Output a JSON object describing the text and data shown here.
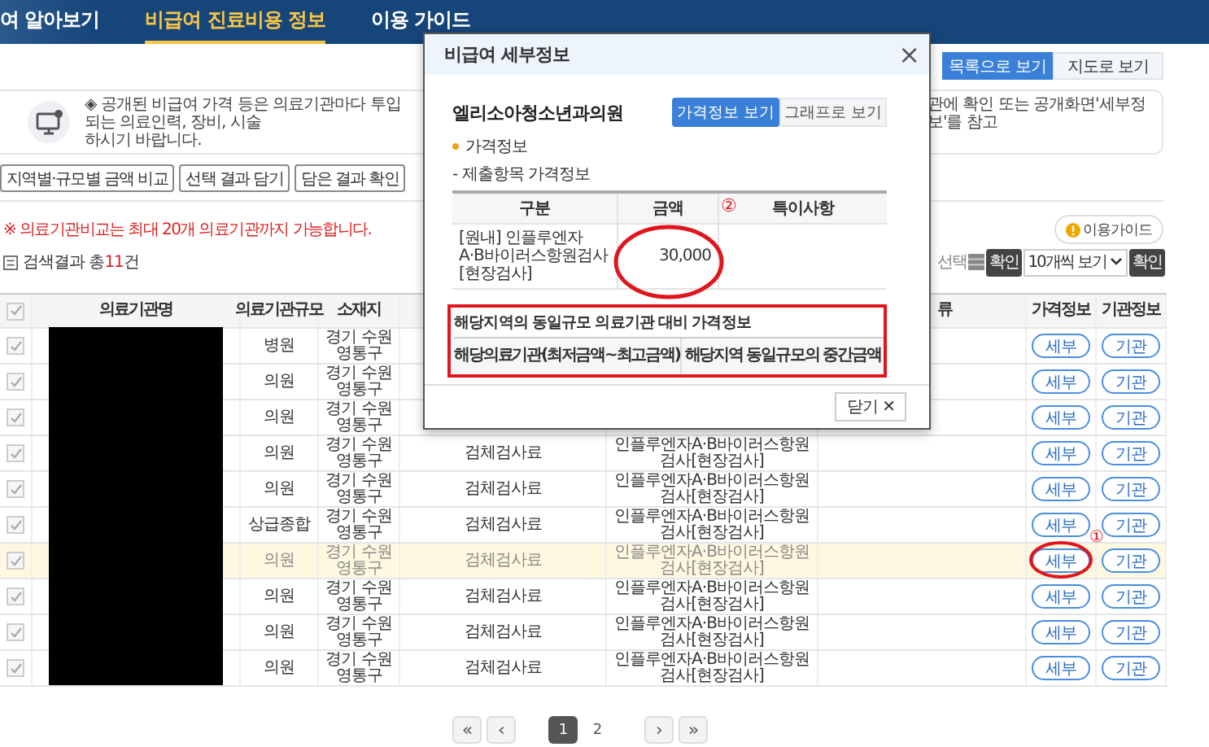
{
  "nav": {
    "items": [
      {
        "label": "여 알아보기",
        "selected": false
      },
      {
        "label": "비급여 진료비용 정보",
        "selected": true
      },
      {
        "label": "이용 가이드",
        "selected": false
      }
    ]
  },
  "view_toggle": [
    {
      "label": "목록으로 보기",
      "selected": true
    },
    {
      "label": "지도로 보기",
      "selected": false
    }
  ],
  "notice": {
    "left_text": "◈ 공개된 비급여 가격 등은 의료기관마다 투입되는 의료인력, 장비, 시술",
    "right_text": "관에 확인 또는 공개화면'세부정보'를 참고",
    "second_line": "하시기 바랍니다."
  },
  "action_buttons": [
    "지역별·규모별 금액 비교",
    "선택 결과 담기",
    "담은 결과 확인"
  ],
  "compare_note": "※ 의료기관비교는 최대 20개 의료기관까지 가능합니다.",
  "guide_button": "이용가이드",
  "result_count": {
    "label": "검색결과 총",
    "count": "11",
    "unit": "건"
  },
  "toolbar": {
    "select_label": "선택",
    "confirm": "확인",
    "page_size": "10개씩 보기",
    "confirm_2": "확인"
  },
  "table": {
    "select_all_checked": true,
    "columns": [
      "의료기관명",
      "의료기관규모",
      "소재지",
      "",
      "",
      "류",
      "가격정보",
      "기관정보"
    ],
    "rows": [
      {
        "checked": true,
        "selected": false,
        "size": "병원",
        "location": "경기 수원영통구",
        "category": "",
        "item": "",
        "detail": "세부",
        "institution": "기관"
      },
      {
        "checked": true,
        "selected": false,
        "size": "의원",
        "location": "경기 수원영통구",
        "category": "",
        "item": "",
        "detail": "세부",
        "institution": "기관"
      },
      {
        "checked": true,
        "selected": false,
        "size": "의원",
        "location": "경기 수원영통구",
        "category": "",
        "item": "",
        "detail": "세부",
        "institution": "기관"
      },
      {
        "checked": true,
        "selected": false,
        "size": "의원",
        "location": "경기 수원영통구",
        "category": "검체검사료",
        "item": "인플루엔자A·B바이러스항원검사[현장검사]",
        "detail": "세부",
        "institution": "기관"
      },
      {
        "checked": true,
        "selected": false,
        "size": "의원",
        "location": "경기 수원영통구",
        "category": "검체검사료",
        "item": "인플루엔자A·B바이러스항원검사[현장검사]",
        "detail": "세부",
        "institution": "기관"
      },
      {
        "checked": true,
        "selected": false,
        "size": "상급종합",
        "location": "경기 수원영통구",
        "category": "검체검사료",
        "item": "인플루엔자A·B바이러스항원검사[현장검사]",
        "detail": "세부",
        "institution": "기관"
      },
      {
        "checked": true,
        "selected": true,
        "size": "의원",
        "location": "경기 수원영통구",
        "category": "검체검사료",
        "item": "인플루엔자A·B바이러스항원검사[현장검사]",
        "detail": "세부",
        "institution": "기관",
        "annotation": "①"
      },
      {
        "checked": true,
        "selected": false,
        "size": "의원",
        "location": "경기 수원영통구",
        "category": "검체검사료",
        "item": "인플루엔자A·B바이러스항원검사[현장검사]",
        "detail": "세부",
        "institution": "기관"
      },
      {
        "checked": true,
        "selected": false,
        "size": "의원",
        "location": "경기 수원영통구",
        "category": "검체검사료",
        "item": "인플루엔자A·B바이러스항원검사[현장검사]",
        "detail": "세부",
        "institution": "기관"
      },
      {
        "checked": true,
        "selected": false,
        "size": "의원",
        "location": "경기 수원영통구",
        "category": "검체검사료",
        "item": "인플루엔자A·B바이러스항원검사[현장검사]",
        "detail": "세부",
        "institution": "기관"
      }
    ]
  },
  "pagination": {
    "first": "«",
    "prev": "‹",
    "pages": [
      {
        "label": "1",
        "selected": true
      },
      {
        "label": "2",
        "selected": false
      }
    ],
    "next": "›",
    "last": "»"
  },
  "modal": {
    "title": "비급여 세부정보",
    "close": "×",
    "clinic": "엘리소아청소년과의원",
    "tabs": [
      {
        "label": "가격정보 보기",
        "selected": true
      },
      {
        "label": "그래프로 보기",
        "selected": false
      }
    ],
    "section": "가격정보",
    "subsection": "- 제출항목 가격정보",
    "price_table": {
      "columns": [
        "구분",
        "금액",
        "특이사항"
      ],
      "rows": [
        {
          "name": "[원내] 인플루엔자 A·B바이러스항원검사[현장검사]",
          "amount": "30,000",
          "note": ""
        }
      ],
      "annotation": "②"
    },
    "compare_section": {
      "title": "해당지역의 동일규모 의료기관 대비 가격정보",
      "columns": [
        "해당의료기관(최저금액~최고금액)",
        "해당지역 동일규모의 중간금액"
      ]
    },
    "close_button": "닫기 ✕"
  }
}
